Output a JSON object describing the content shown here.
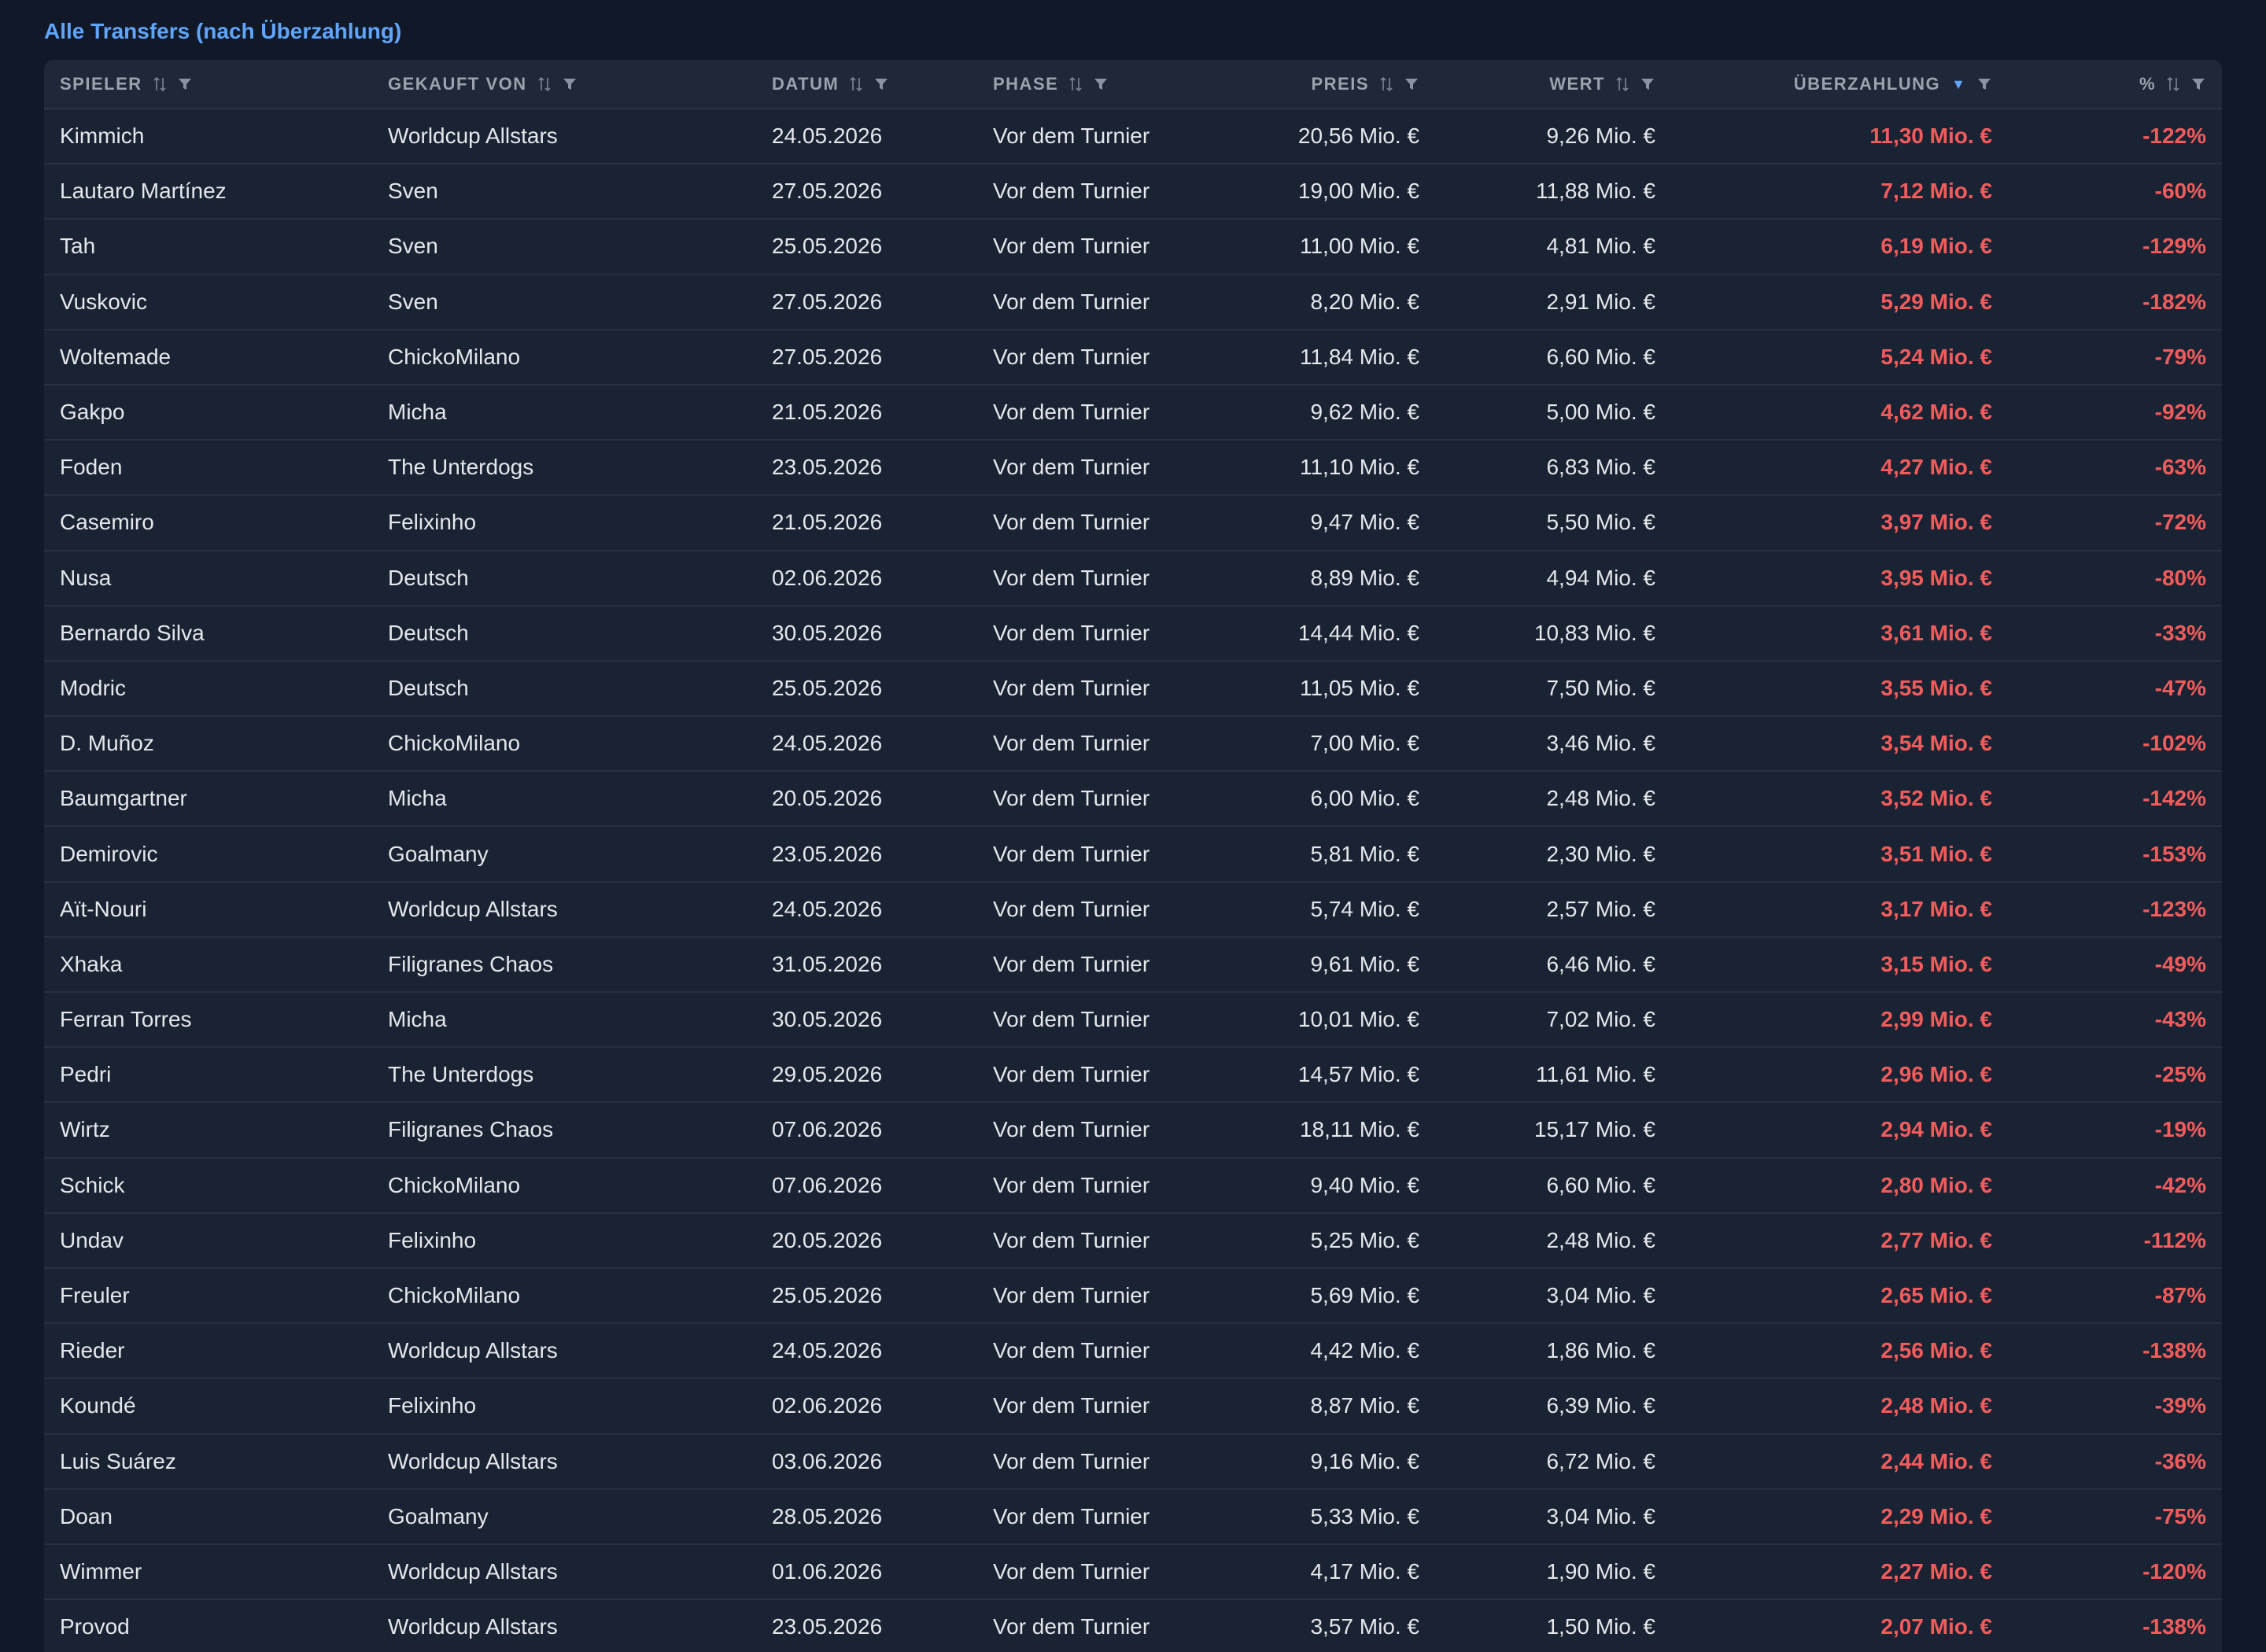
{
  "section_title": "Alle Transfers (nach Überzahlung)",
  "colors": {
    "accent": "#60a5fa",
    "negative": "#f25c5c",
    "background": "#111827",
    "table_bg": "#1a2333"
  },
  "columns": [
    {
      "label": "Spieler",
      "align": "left",
      "sort": "none"
    },
    {
      "label": "Gekauft von",
      "align": "left",
      "sort": "none"
    },
    {
      "label": "Datum",
      "align": "left",
      "sort": "none"
    },
    {
      "label": "Phase",
      "align": "left",
      "sort": "none"
    },
    {
      "label": "Preis",
      "align": "right",
      "sort": "none"
    },
    {
      "label": "Wert",
      "align": "right",
      "sort": "none"
    },
    {
      "label": "Überzahlung",
      "align": "right",
      "sort": "desc"
    },
    {
      "label": "%",
      "align": "right",
      "sort": "none"
    }
  ],
  "rows": [
    [
      "Kimmich",
      "Worldcup Allstars",
      "24.05.2026",
      "Vor dem Turnier",
      "20,56 Mio. €",
      "9,26 Mio. €",
      "11,30 Mio. €",
      "-122%"
    ],
    [
      "Lautaro Martínez",
      "Sven",
      "27.05.2026",
      "Vor dem Turnier",
      "19,00 Mio. €",
      "11,88 Mio. €",
      "7,12 Mio. €",
      "-60%"
    ],
    [
      "Tah",
      "Sven",
      "25.05.2026",
      "Vor dem Turnier",
      "11,00 Mio. €",
      "4,81 Mio. €",
      "6,19 Mio. €",
      "-129%"
    ],
    [
      "Vuskovic",
      "Sven",
      "27.05.2026",
      "Vor dem Turnier",
      "8,20 Mio. €",
      "2,91 Mio. €",
      "5,29 Mio. €",
      "-182%"
    ],
    [
      "Woltemade",
      "ChickoMilano",
      "27.05.2026",
      "Vor dem Turnier",
      "11,84 Mio. €",
      "6,60 Mio. €",
      "5,24 Mio. €",
      "-79%"
    ],
    [
      "Gakpo",
      "Micha",
      "21.05.2026",
      "Vor dem Turnier",
      "9,62 Mio. €",
      "5,00 Mio. €",
      "4,62 Mio. €",
      "-92%"
    ],
    [
      "Foden",
      "The Unterdogs",
      "23.05.2026",
      "Vor dem Turnier",
      "11,10 Mio. €",
      "6,83 Mio. €",
      "4,27 Mio. €",
      "-63%"
    ],
    [
      "Casemiro",
      "Felixinho",
      "21.05.2026",
      "Vor dem Turnier",
      "9,47 Mio. €",
      "5,50 Mio. €",
      "3,97 Mio. €",
      "-72%"
    ],
    [
      "Nusa",
      "Deutsch",
      "02.06.2026",
      "Vor dem Turnier",
      "8,89 Mio. €",
      "4,94 Mio. €",
      "3,95 Mio. €",
      "-80%"
    ],
    [
      "Bernardo Silva",
      "Deutsch",
      "30.05.2026",
      "Vor dem Turnier",
      "14,44 Mio. €",
      "10,83 Mio. €",
      "3,61 Mio. €",
      "-33%"
    ],
    [
      "Modric",
      "Deutsch",
      "25.05.2026",
      "Vor dem Turnier",
      "11,05 Mio. €",
      "7,50 Mio. €",
      "3,55 Mio. €",
      "-47%"
    ],
    [
      "D. Muñoz",
      "ChickoMilano",
      "24.05.2026",
      "Vor dem Turnier",
      "7,00 Mio. €",
      "3,46 Mio. €",
      "3,54 Mio. €",
      "-102%"
    ],
    [
      "Baumgartner",
      "Micha",
      "20.05.2026",
      "Vor dem Turnier",
      "6,00 Mio. €",
      "2,48 Mio. €",
      "3,52 Mio. €",
      "-142%"
    ],
    [
      "Demirovic",
      "Goalmany",
      "23.05.2026",
      "Vor dem Turnier",
      "5,81 Mio. €",
      "2,30 Mio. €",
      "3,51 Mio. €",
      "-153%"
    ],
    [
      "Aït-Nouri",
      "Worldcup Allstars",
      "24.05.2026",
      "Vor dem Turnier",
      "5,74 Mio. €",
      "2,57 Mio. €",
      "3,17 Mio. €",
      "-123%"
    ],
    [
      "Xhaka",
      "Filigranes Chaos",
      "31.05.2026",
      "Vor dem Turnier",
      "9,61 Mio. €",
      "6,46 Mio. €",
      "3,15 Mio. €",
      "-49%"
    ],
    [
      "Ferran Torres",
      "Micha",
      "30.05.2026",
      "Vor dem Turnier",
      "10,01 Mio. €",
      "7,02 Mio. €",
      "2,99 Mio. €",
      "-43%"
    ],
    [
      "Pedri",
      "The Unterdogs",
      "29.05.2026",
      "Vor dem Turnier",
      "14,57 Mio. €",
      "11,61 Mio. €",
      "2,96 Mio. €",
      "-25%"
    ],
    [
      "Wirtz",
      "Filigranes Chaos",
      "07.06.2026",
      "Vor dem Turnier",
      "18,11 Mio. €",
      "15,17 Mio. €",
      "2,94 Mio. €",
      "-19%"
    ],
    [
      "Schick",
      "ChickoMilano",
      "07.06.2026",
      "Vor dem Turnier",
      "9,40 Mio. €",
      "6,60 Mio. €",
      "2,80 Mio. €",
      "-42%"
    ],
    [
      "Undav",
      "Felixinho",
      "20.05.2026",
      "Vor dem Turnier",
      "5,25 Mio. €",
      "2,48 Mio. €",
      "2,77 Mio. €",
      "-112%"
    ],
    [
      "Freuler",
      "ChickoMilano",
      "25.05.2026",
      "Vor dem Turnier",
      "5,69 Mio. €",
      "3,04 Mio. €",
      "2,65 Mio. €",
      "-87%"
    ],
    [
      "Rieder",
      "Worldcup Allstars",
      "24.05.2026",
      "Vor dem Turnier",
      "4,42 Mio. €",
      "1,86 Mio. €",
      "2,56 Mio. €",
      "-138%"
    ],
    [
      "Koundé",
      "Felixinho",
      "02.06.2026",
      "Vor dem Turnier",
      "8,87 Mio. €",
      "6,39 Mio. €",
      "2,48 Mio. €",
      "-39%"
    ],
    [
      "Luis Suárez",
      "Worldcup Allstars",
      "03.06.2026",
      "Vor dem Turnier",
      "9,16 Mio. €",
      "6,72 Mio. €",
      "2,44 Mio. €",
      "-36%"
    ],
    [
      "Doan",
      "Goalmany",
      "28.05.2026",
      "Vor dem Turnier",
      "5,33 Mio. €",
      "3,04 Mio. €",
      "2,29 Mio. €",
      "-75%"
    ],
    [
      "Wimmer",
      "Worldcup Allstars",
      "01.06.2026",
      "Vor dem Turnier",
      "4,17 Mio. €",
      "1,90 Mio. €",
      "2,27 Mio. €",
      "-120%"
    ],
    [
      "Provod",
      "Worldcup Allstars",
      "23.05.2026",
      "Vor dem Turnier",
      "3,57 Mio. €",
      "1,50 Mio. €",
      "2,07 Mio. €",
      "-138%"
    ]
  ]
}
